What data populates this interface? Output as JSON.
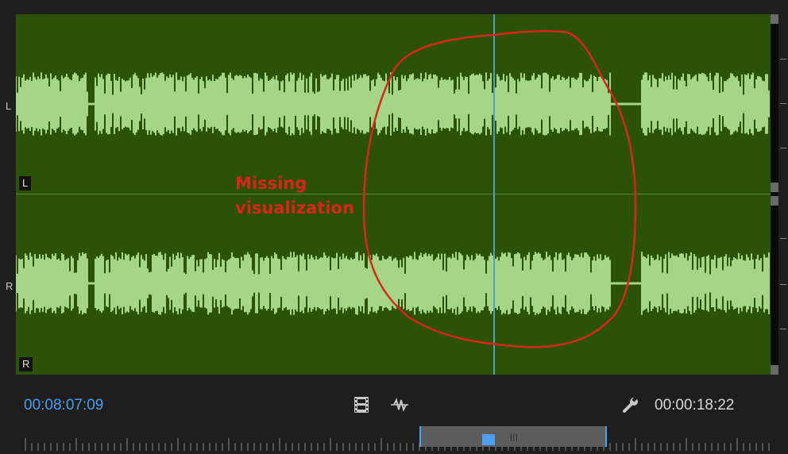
{
  "waveform": {
    "channels": [
      {
        "ruler_label": "L",
        "badge": "L"
      },
      {
        "ruler_label": "R",
        "badge": "R"
      }
    ],
    "colors": {
      "background": "#2b5207",
      "wave": "#a4d685",
      "playhead": "#4a9fd6"
    }
  },
  "annotation": {
    "line1": "Missing",
    "line2": "visualization",
    "color": "#d8261b"
  },
  "controls": {
    "current_timecode": "00:08:07:09",
    "duration_timecode": "00:00:18:22",
    "icons": [
      "film-clip-icon",
      "audio-waveform-icon",
      "wrench-icon"
    ]
  }
}
